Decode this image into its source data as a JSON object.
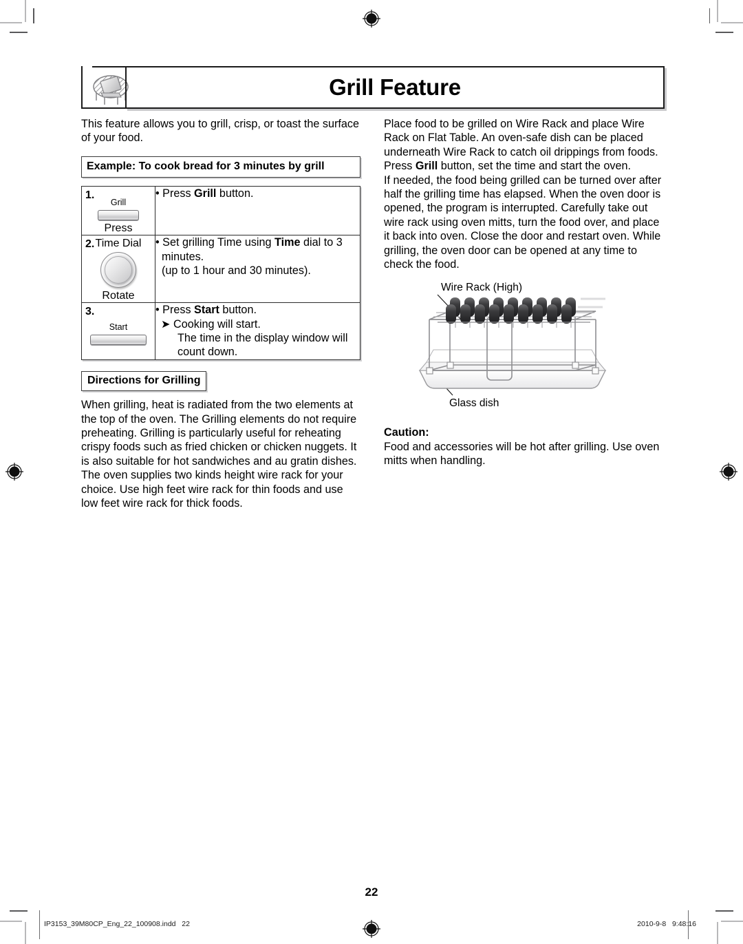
{
  "header": {
    "title": "Grill Feature",
    "icon": "grill-rack-with-toast-icon"
  },
  "left_column": {
    "intro": "This feature allows you to grill, crisp, or toast the surface of your food.",
    "example_heading": "Example: To cook bread for 3 minutes by grill",
    "steps": [
      {
        "number": "1.",
        "control_label": "Grill",
        "control_type": "push-button",
        "action_label": "Press",
        "lines": [
          {
            "text_prefix": "• Press ",
            "bold": "Grill",
            "text_suffix": " button."
          }
        ]
      },
      {
        "number": "2.",
        "control_label": "Time Dial",
        "control_type": "rotary-dial",
        "action_label": "Rotate",
        "lines": [
          {
            "text_prefix": "• Set grilling Time using ",
            "bold": "Time",
            "text_suffix": " dial to 3 minutes."
          },
          {
            "text_prefix": "(up to 1 hour and 30 minutes).",
            "bold": "",
            "text_suffix": ""
          }
        ]
      },
      {
        "number": "3.",
        "control_label": "Start",
        "control_type": "push-button",
        "action_label": "",
        "lines": [
          {
            "text_prefix": "• Press ",
            "bold": "Start",
            "text_suffix": " button."
          },
          {
            "text_prefix": "➤ Cooking will start.",
            "bold": "",
            "text_suffix": ""
          },
          {
            "text_prefix": "The time in the display window will count down.",
            "bold": "",
            "text_suffix": ""
          }
        ]
      }
    ],
    "directions_heading": "Directions for Grilling",
    "directions_text": "When grilling, heat is radiated from the two elements at the top of the oven. The Grilling elements do not require preheating. Grilling is particularly useful for reheating crispy foods such as fried chicken or chicken nuggets. It is also suitable for hot sandwiches and au gratin dishes. The oven supplies two kinds height wire rack for your choice. Use high feet wire rack for thin foods and use low feet wire rack for thick foods."
  },
  "right_column": {
    "para1_a": "Place food to be grilled on Wire Rack and place Wire Rack on Flat Table. An oven-safe dish can be placed underneath Wire Rack to catch oil drippings from foods. Press ",
    "para1_bold": "Grill",
    "para1_b": " button, set the time and start the oven.",
    "para2": "If needed, the food being grilled can be turned over after half the grilling time has elapsed. When the oven door is opened, the program is interrupted. Carefully take out wire rack using oven mitts, turn the food over, and place it back into oven. Close the door and restart oven. While grilling, the oven door can be opened at any time to check the food.",
    "diagram": {
      "label_top": "Wire Rack (High)",
      "label_bottom": "Glass dish",
      "name": "wire-rack-on-glass-dish-diagram"
    },
    "caution_title": "Caution:",
    "caution_text": "Food and accessories will be hot after grilling. Use oven mitts when handling."
  },
  "footer": {
    "page_number": "22",
    "file_reference": "IP3153_39M80CP_Eng_22_100908.indd   22",
    "timestamp": "2010-9-8   9:48:16"
  }
}
